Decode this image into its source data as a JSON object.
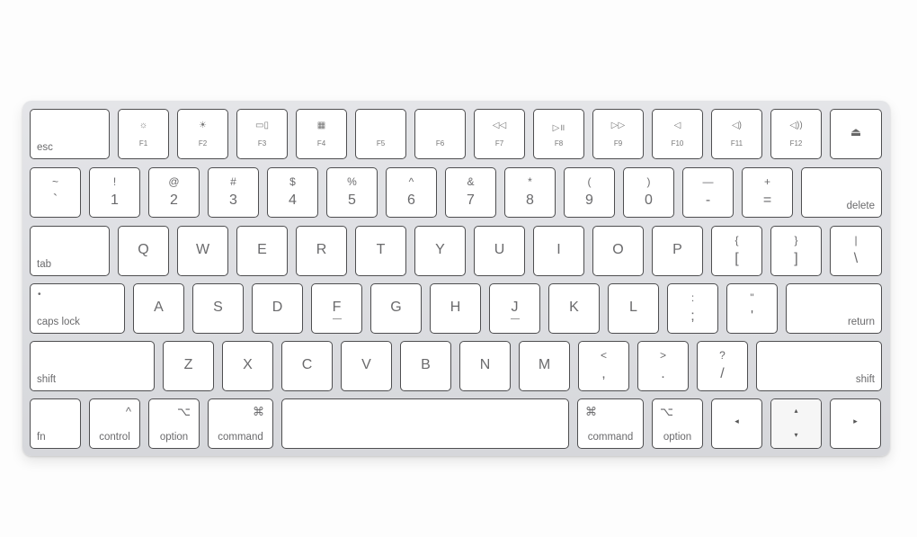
{
  "keyboard": {
    "body_color": "#d9dadd",
    "rows": [
      [
        {
          "kind": "word",
          "label": "esc",
          "align": "l"
        },
        {
          "kind": "fn",
          "icon": "☼",
          "label": "F1",
          "icon_name": "brightness-down-icon"
        },
        {
          "kind": "fn",
          "icon": "☀",
          "label": "F2",
          "icon_name": "brightness-up-icon"
        },
        {
          "kind": "fn",
          "icon": "▭▯",
          "label": "F3",
          "icon_name": "mission-control-icon"
        },
        {
          "kind": "fn",
          "icon": "▦",
          "label": "F4",
          "icon_name": "launchpad-icon"
        },
        {
          "kind": "fn",
          "icon": "",
          "label": "F5"
        },
        {
          "kind": "fn",
          "icon": "",
          "label": "F6"
        },
        {
          "kind": "fn",
          "icon": "◁◁",
          "label": "F7",
          "icon_name": "rewind-icon"
        },
        {
          "kind": "fn",
          "icon": "▷॥",
          "label": "F8",
          "icon_name": "play-pause-icon"
        },
        {
          "kind": "fn",
          "icon": "▷▷",
          "label": "F9",
          "icon_name": "fast-forward-icon"
        },
        {
          "kind": "fn",
          "icon": "◁",
          "label": "F10",
          "icon_name": "mute-icon"
        },
        {
          "kind": "fn",
          "icon": "◁)",
          "label": "F11",
          "icon_name": "volume-down-icon"
        },
        {
          "kind": "fn",
          "icon": "◁))",
          "label": "F12",
          "icon_name": "volume-up-icon"
        },
        {
          "kind": "eject",
          "icon": "⏏",
          "icon_name": "eject-icon"
        }
      ],
      [
        {
          "kind": "dual",
          "top": "~",
          "bottom": "`"
        },
        {
          "kind": "dual",
          "top": "!",
          "bottom": "1"
        },
        {
          "kind": "dual",
          "top": "@",
          "bottom": "2"
        },
        {
          "kind": "dual",
          "top": "#",
          "bottom": "3"
        },
        {
          "kind": "dual",
          "top": "$",
          "bottom": "4"
        },
        {
          "kind": "dual",
          "top": "%",
          "bottom": "5"
        },
        {
          "kind": "dual",
          "top": "^",
          "bottom": "6"
        },
        {
          "kind": "dual",
          "top": "&",
          "bottom": "7"
        },
        {
          "kind": "dual",
          "top": "*",
          "bottom": "8"
        },
        {
          "kind": "dual",
          "top": "(",
          "bottom": "9"
        },
        {
          "kind": "dual",
          "top": ")",
          "bottom": "0"
        },
        {
          "kind": "dual",
          "top": "—",
          "bottom": "-"
        },
        {
          "kind": "dual",
          "top": "+",
          "bottom": "="
        },
        {
          "kind": "word",
          "label": "delete",
          "align": "r"
        }
      ],
      [
        {
          "kind": "word",
          "label": "tab",
          "align": "l"
        },
        {
          "kind": "char",
          "main": "Q"
        },
        {
          "kind": "char",
          "main": "W"
        },
        {
          "kind": "char",
          "main": "E"
        },
        {
          "kind": "char",
          "main": "R"
        },
        {
          "kind": "char",
          "main": "T"
        },
        {
          "kind": "char",
          "main": "Y"
        },
        {
          "kind": "char",
          "main": "U"
        },
        {
          "kind": "char",
          "main": "I"
        },
        {
          "kind": "char",
          "main": "O"
        },
        {
          "kind": "char",
          "main": "P"
        },
        {
          "kind": "dual",
          "top": "{",
          "bottom": "["
        },
        {
          "kind": "dual",
          "top": "}",
          "bottom": "]"
        },
        {
          "kind": "dual",
          "top": "|",
          "bottom": "\\"
        }
      ],
      [
        {
          "kind": "word",
          "label": "caps lock",
          "align": "l",
          "sym": "•"
        },
        {
          "kind": "char",
          "main": "A"
        },
        {
          "kind": "char",
          "main": "S"
        },
        {
          "kind": "char",
          "main": "D"
        },
        {
          "kind": "char",
          "main": "F",
          "nub": true
        },
        {
          "kind": "char",
          "main": "G"
        },
        {
          "kind": "char",
          "main": "H"
        },
        {
          "kind": "char",
          "main": "J",
          "nub": true
        },
        {
          "kind": "char",
          "main": "K"
        },
        {
          "kind": "char",
          "main": "L"
        },
        {
          "kind": "dual",
          "top": ":",
          "bottom": ";"
        },
        {
          "kind": "dual",
          "top": "\"",
          "bottom": "'"
        },
        {
          "kind": "word",
          "label": "return",
          "align": "r"
        }
      ],
      [
        {
          "kind": "word",
          "label": "shift",
          "align": "l"
        },
        {
          "kind": "char",
          "main": "Z"
        },
        {
          "kind": "char",
          "main": "X"
        },
        {
          "kind": "char",
          "main": "C"
        },
        {
          "kind": "char",
          "main": "V"
        },
        {
          "kind": "char",
          "main": "B"
        },
        {
          "kind": "char",
          "main": "N"
        },
        {
          "kind": "char",
          "main": "M"
        },
        {
          "kind": "dual",
          "top": "<",
          "bottom": ","
        },
        {
          "kind": "dual",
          "top": ">",
          "bottom": "."
        },
        {
          "kind": "dual",
          "top": "?",
          "bottom": "/"
        },
        {
          "kind": "word",
          "label": "shift",
          "align": "r"
        }
      ],
      [
        {
          "kind": "word",
          "label": "fn",
          "align": "l"
        },
        {
          "kind": "word",
          "label": "control",
          "align": "c",
          "sym": "^",
          "symalign": "r"
        },
        {
          "kind": "word",
          "label": "option",
          "align": "c",
          "sym": "⌥",
          "symalign": "r"
        },
        {
          "kind": "word",
          "label": "command",
          "align": "c",
          "sym": "⌘",
          "symalign": "r"
        },
        {
          "kind": "space"
        },
        {
          "kind": "word",
          "label": "command",
          "align": "c",
          "sym": "⌘",
          "symalign": "l"
        },
        {
          "kind": "word",
          "label": "option",
          "align": "c",
          "sym": "⌥",
          "symalign": "l"
        },
        {
          "kind": "arrow",
          "icon": "◂",
          "icon_name": "arrow-left-icon"
        },
        {
          "kind": "updown",
          "up": "▴",
          "down": "▾"
        },
        {
          "kind": "arrow",
          "icon": "▸",
          "icon_name": "arrow-right-icon"
        }
      ]
    ]
  }
}
